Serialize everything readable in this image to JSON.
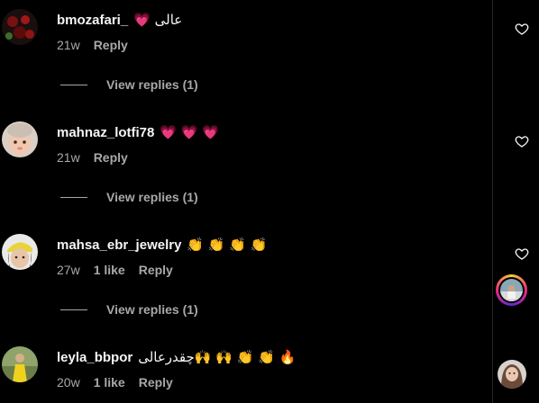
{
  "comments": [
    {
      "username": "bmozafari_",
      "text": "💗 عالی",
      "time": "21w",
      "likes": "",
      "reply_label": "Reply",
      "view_replies": "View replies (1)",
      "avatar_icon": "avatar-dark-red-flowers"
    },
    {
      "username": "mahnaz_lotfi78",
      "text": "💗 💗 💗",
      "time": "21w",
      "likes": "",
      "reply_label": "Reply",
      "view_replies": "View replies (1)",
      "avatar_icon": "avatar-baby"
    },
    {
      "username": "mahsa_ebr_jewelry",
      "text": "👏 👏 👏 👏",
      "time": "27w",
      "likes": "1 like",
      "reply_label": "Reply",
      "view_replies": "View replies (1)",
      "avatar_icon": "avatar-yellow-cap"
    },
    {
      "username": "leyla_bbpor",
      "text": "چقدرعالی🙌 🙌 👏 👏 🔥",
      "time": "20w",
      "likes": "1 like",
      "reply_label": "Reply",
      "view_replies": "",
      "avatar_icon": "avatar-yellow-dress"
    }
  ],
  "icons": {
    "like": "heart-outline-icon",
    "story": "story-ring-avatar",
    "side": "side-avatar"
  },
  "colors": {
    "background": "#000000",
    "text": "#f5f5f5",
    "secondary": "#a8a8a8",
    "heart_emoji": "#ff3b6b"
  }
}
